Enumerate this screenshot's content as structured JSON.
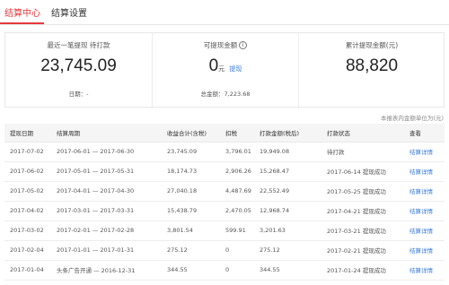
{
  "tabs": [
    {
      "label": "结算中心"
    },
    {
      "label": "结算设置"
    }
  ],
  "summary": {
    "last_withdraw": {
      "label": "最近一笔提现 待打款",
      "amount": "23,745.09",
      "date_label": "日期：-"
    },
    "available": {
      "label": "可提现金额",
      "info": "i",
      "amount": "0",
      "unit": "元",
      "link": "提现",
      "total_label": "总金额：7,223.68"
    },
    "cumulative": {
      "label": "累计提现金额(元)",
      "amount": "88,820"
    }
  },
  "note": "本报表内金额单位为(元)",
  "table": {
    "headers": [
      "提现日期",
      "结算周期",
      "收益合计(含税)",
      "扣税",
      "打款金额(税后)",
      "打款状态",
      "查看"
    ],
    "rows": [
      {
        "date": "2017-07-02",
        "period": "2017-06-01 — 2017-06-30",
        "income": "23,745.09",
        "tax": "3,796.01",
        "payout": "19,949.08",
        "status": "待打款",
        "action": "结算详情"
      },
      {
        "date": "2017-06-02",
        "period": "2017-05-01 — 2017-05-31",
        "income": "18,174.73",
        "tax": "2,906.26",
        "payout": "15,268.47",
        "status": "2017-06-14 提现成功",
        "action": "结算详情"
      },
      {
        "date": "2017-05-02",
        "period": "2017-04-01 — 2017-04-30",
        "income": "27,040.18",
        "tax": "4,487.69",
        "payout": "22,552.49",
        "status": "2017-05-25 提现成功",
        "action": "结算详情"
      },
      {
        "date": "2017-04-02",
        "period": "2017-03-01 — 2017-03-31",
        "income": "15,438.79",
        "tax": "2,470.05",
        "payout": "12,968.74",
        "status": "2017-04-21 提现成功",
        "action": "结算详情"
      },
      {
        "date": "2017-03-02",
        "period": "2017-02-01 — 2017-02-28",
        "income": "3,801.54",
        "tax": "599.91",
        "payout": "3,201.63",
        "status": "2017-03-21 提现成功",
        "action": "结算详情"
      },
      {
        "date": "2017-02-04",
        "period": "2017-01-01 — 2017-01-31",
        "income": "275.12",
        "tax": "0",
        "payout": "275.12",
        "status": "2017-02-21 提现成功",
        "action": "结算详情"
      },
      {
        "date": "2017-01-04",
        "period": "头条广告开通 — 2016-12-31",
        "income": "344.55",
        "tax": "0",
        "payout": "344.55",
        "status": "2017-01-24 提现成功",
        "action": "结算详情"
      }
    ]
  },
  "colors": {
    "accent": "#e4393c",
    "link": "#3a7bd5"
  }
}
